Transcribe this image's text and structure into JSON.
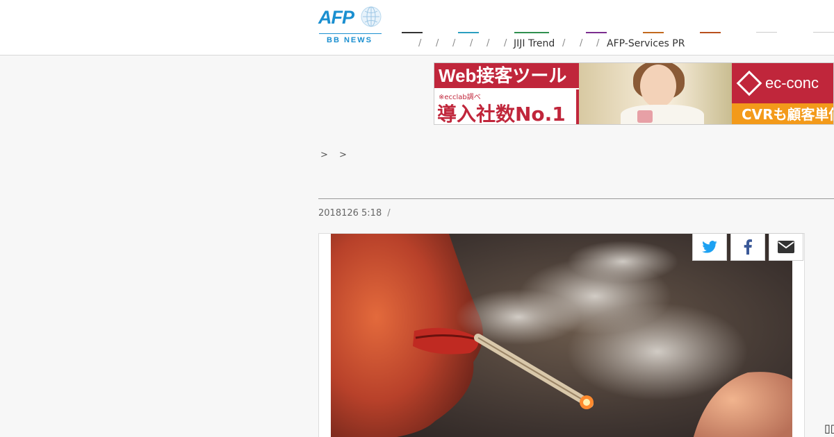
{
  "header": {
    "logo": {
      "text": "AFP",
      "subtext": "BB NEWS"
    },
    "nav": [
      {
        "label": "",
        "color": "#333333"
      },
      {
        "label": "",
        "color": "#2a9fc0"
      },
      {
        "label": "",
        "color": "#2f8f4e"
      },
      {
        "label": "",
        "color": "#7b2d8e"
      },
      {
        "label": "",
        "color": "#c2691e"
      },
      {
        "label": "JIJI Trend",
        "color": "#b84f1d"
      },
      {
        "label": "",
        "color": "#cccccc"
      },
      {
        "label": "AFP-Services PR",
        "color": "#cccccc"
      }
    ],
    "separator": "/"
  },
  "ad": {
    "left_headline": "Web接客ツール",
    "left_note": "※ecclab調べ",
    "left_big": "導入社数No.1",
    "right_brand": "ec-conc",
    "right_bottom": "CVRも顧客単価"
  },
  "article": {
    "breadcrumb": "> >",
    "title": "",
    "date": "2018126 5:18",
    "date_separator": "/"
  },
  "share": [
    {
      "icon": "twitter-icon",
      "color": "#1da1f2"
    },
    {
      "icon": "facebook-icon",
      "color": "#3b5998"
    },
    {
      "icon": "mail-icon",
      "color": "#333333"
    }
  ],
  "colors": {
    "accent": "#1a8fd0",
    "ad_red": "#c0263b",
    "ad_orange": "#f39a1a"
  }
}
